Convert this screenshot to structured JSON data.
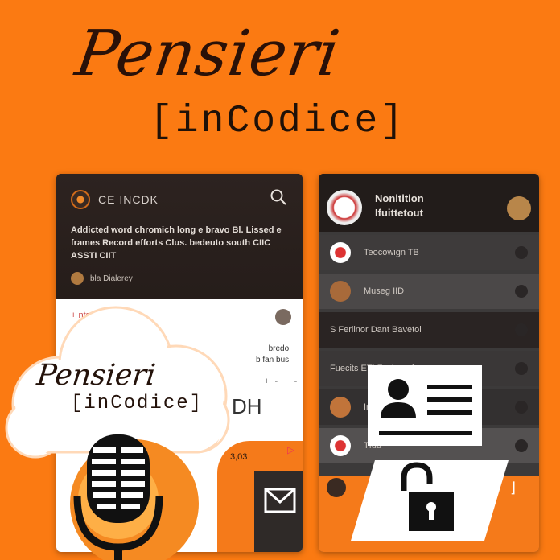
{
  "header": {
    "title": "Pensieri",
    "subtitle": "[inCodice]"
  },
  "left_phone": {
    "app_name": "CE INCDK",
    "description": "Addicted word chromich long e bravo Bl. Lissed e frames Record efforts Clus. bedeuto south CIIC ASSTI CIIT",
    "author": "bla Dialerey",
    "row_label": "+ ntsne",
    "tags": "bredo\nb fan bus",
    "dots": "+ - + -",
    "big_text": "DH",
    "number": "3,03",
    "play_icon": "play-icon"
  },
  "right_phone": {
    "header_title": "Nonitition\nIfuittetout",
    "items": [
      {
        "label": "Teocowign TB"
      },
      {
        "label": "Museg IID"
      },
      {
        "label": "S Ferllnor Dant Bavetol"
      },
      {
        "label": "Fuecits ETI Fushcerd"
      },
      {
        "label": "Iracic"
      },
      {
        "label": "Tfuu"
      }
    ]
  },
  "cloud_logo": {
    "title": "Pensieri",
    "subtitle": "[inCodice]"
  },
  "icons": {
    "search": "search-icon",
    "id_card": "id-card-icon",
    "unlock": "unlock-icon",
    "microphone": "microphone-icon"
  },
  "colors": {
    "background": "#fb7a12",
    "dark": "#241a17",
    "accent": "#f57a1a"
  }
}
